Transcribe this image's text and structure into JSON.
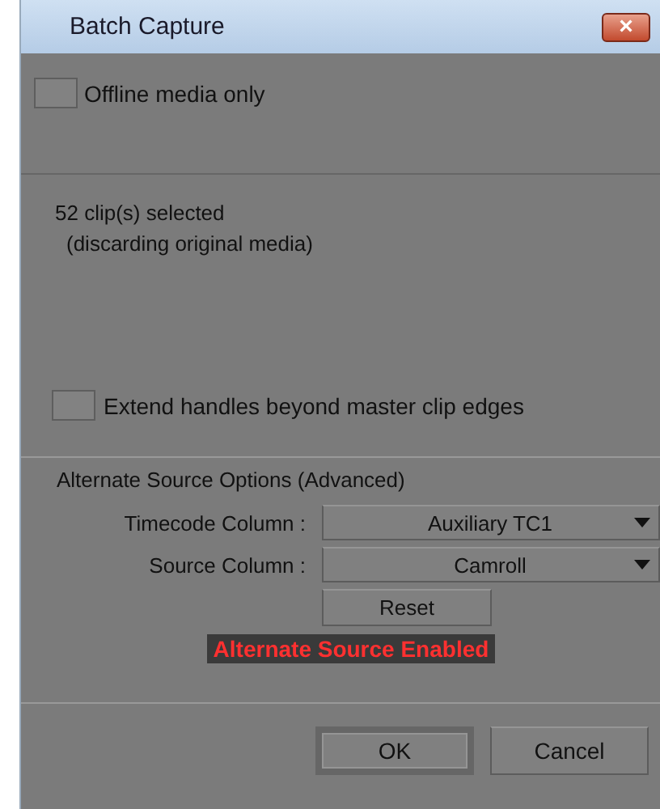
{
  "window": {
    "title": "Batch Capture",
    "close": "×"
  },
  "offline_only": {
    "label": "Offline media only",
    "checked": false
  },
  "selection": {
    "count": "52 clip(s) selected",
    "note": "(discarding original media)"
  },
  "extend_handles": {
    "label": "Extend handles beyond master clip edges",
    "checked": false
  },
  "alternate_source": {
    "heading": "Alternate Source Options (Advanced)",
    "fields": [
      {
        "label": "Timecode Column :",
        "value": "Auxiliary TC1"
      },
      {
        "label": "Source Column :",
        "value": "Camroll"
      }
    ],
    "reset": "Reset",
    "status": "Alternate Source Enabled"
  },
  "buttons": [
    {
      "label": "OK",
      "default": true
    },
    {
      "label": "Cancel",
      "default": false
    }
  ]
}
